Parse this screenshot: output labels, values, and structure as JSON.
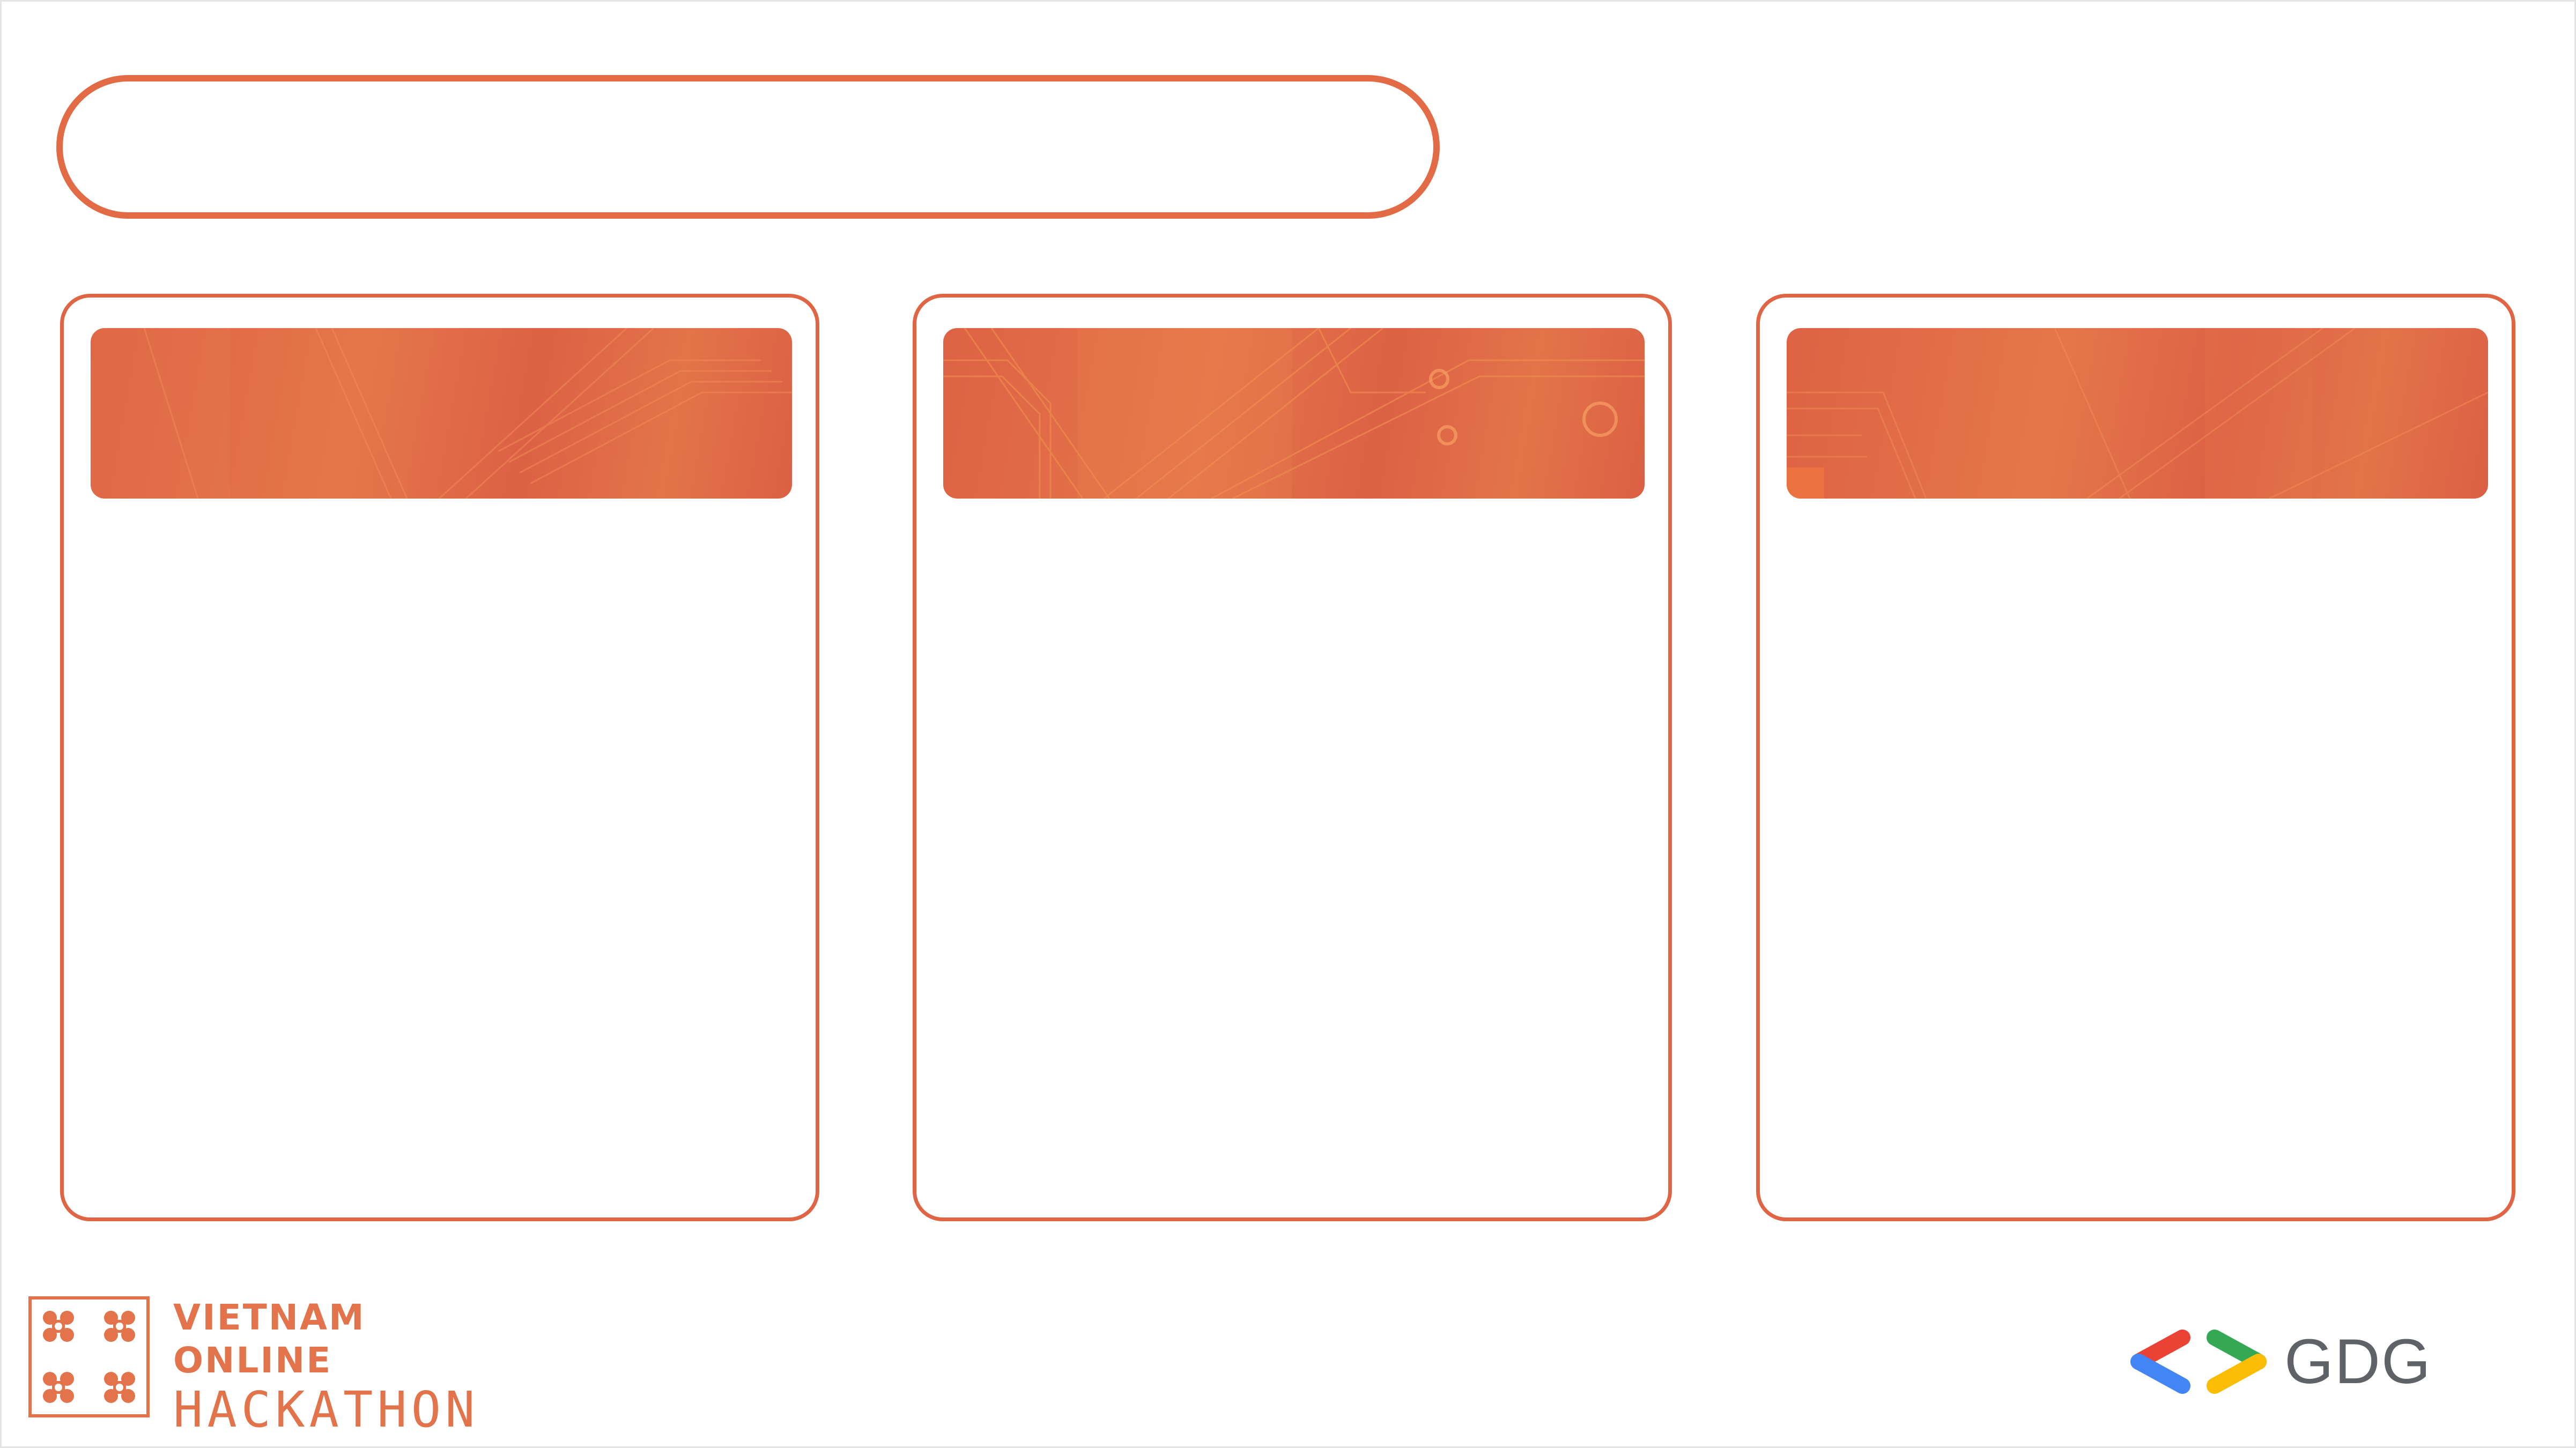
{
  "slide": {
    "title_placeholder": "",
    "cards": [
      {
        "header_text": "",
        "body_text": ""
      },
      {
        "header_text": "",
        "body_text": ""
      },
      {
        "header_text": "",
        "body_text": ""
      }
    ]
  },
  "branding": {
    "hackathon_logo": {
      "line1": "VIETNAM",
      "line2": "ONLINE",
      "line3": "HACKATHON",
      "icon": "grid-of-dots-logo-icon",
      "color": "#e2734a"
    },
    "gdg_logo": {
      "text": "GDG",
      "icon": "chevron-brackets-icon",
      "colors": {
        "red": "#ea4335",
        "blue": "#4285f4",
        "green": "#34a853",
        "yellow": "#fbbc04",
        "text": "#5f6368"
      }
    }
  },
  "theme": {
    "accent": "#e26a45",
    "background": "#ffffff"
  }
}
